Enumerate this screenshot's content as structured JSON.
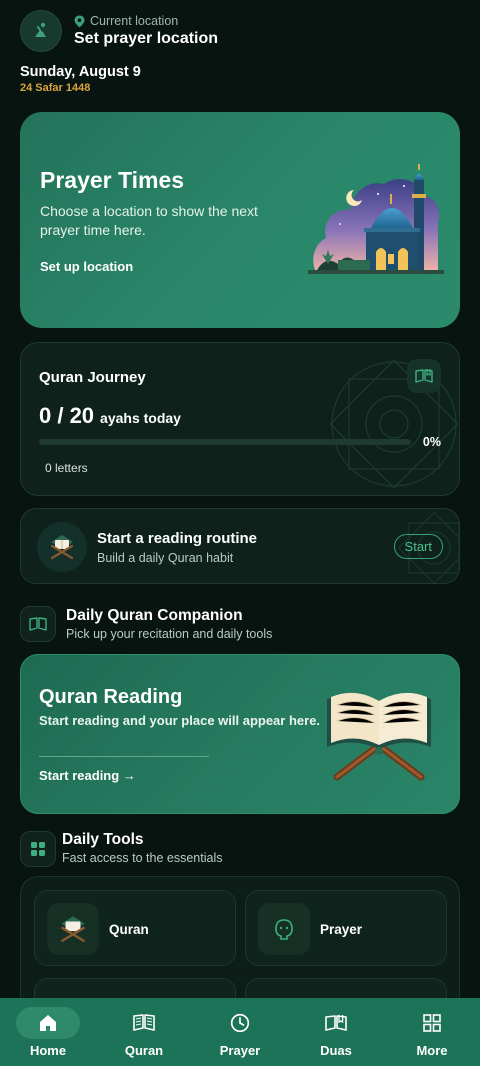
{
  "header": {
    "location_label": "Current location",
    "location_title": "Set prayer location",
    "date": "Sunday, August 9",
    "hijri_date": "24 Safar 1448"
  },
  "prayer_card": {
    "title": "Prayer Times",
    "description": "Choose a location to show the next prayer time here.",
    "link": "Set up location"
  },
  "journey": {
    "title": "Quran Journey",
    "count": "0 / 20",
    "unit": "ayahs today",
    "progress": 0,
    "percent_label": "0%",
    "letters": "0 letters"
  },
  "routine": {
    "title": "Start a reading routine",
    "subtitle": "Build a daily Quran habit",
    "button": "Start"
  },
  "companion": {
    "title": "Daily Quran Companion",
    "subtitle": "Pick up your recitation and daily tools"
  },
  "reading_card": {
    "title": "Quran Reading",
    "subtitle": "Start reading and your place will appear here.",
    "link": "Start reading →"
  },
  "tools": {
    "title": "Daily Tools",
    "subtitle": "Fast access to the essentials",
    "items": [
      {
        "label": "Quran",
        "icon": "quran-stand-icon"
      },
      {
        "label": "Prayer",
        "icon": "prayer-icon"
      }
    ]
  },
  "nav": {
    "items": [
      {
        "label": "Home",
        "icon": "home-icon",
        "active": true
      },
      {
        "label": "Quran",
        "icon": "book-icon",
        "active": false
      },
      {
        "label": "Prayer",
        "icon": "clock-icon",
        "active": false
      },
      {
        "label": "Duas",
        "icon": "open-book-icon",
        "active": false
      },
      {
        "label": "More",
        "icon": "grid-icon",
        "active": false
      }
    ]
  },
  "colors": {
    "background": "#08140f",
    "accent": "#2a876a",
    "hijri": "#d9a33f",
    "nav": "#1d7358"
  }
}
